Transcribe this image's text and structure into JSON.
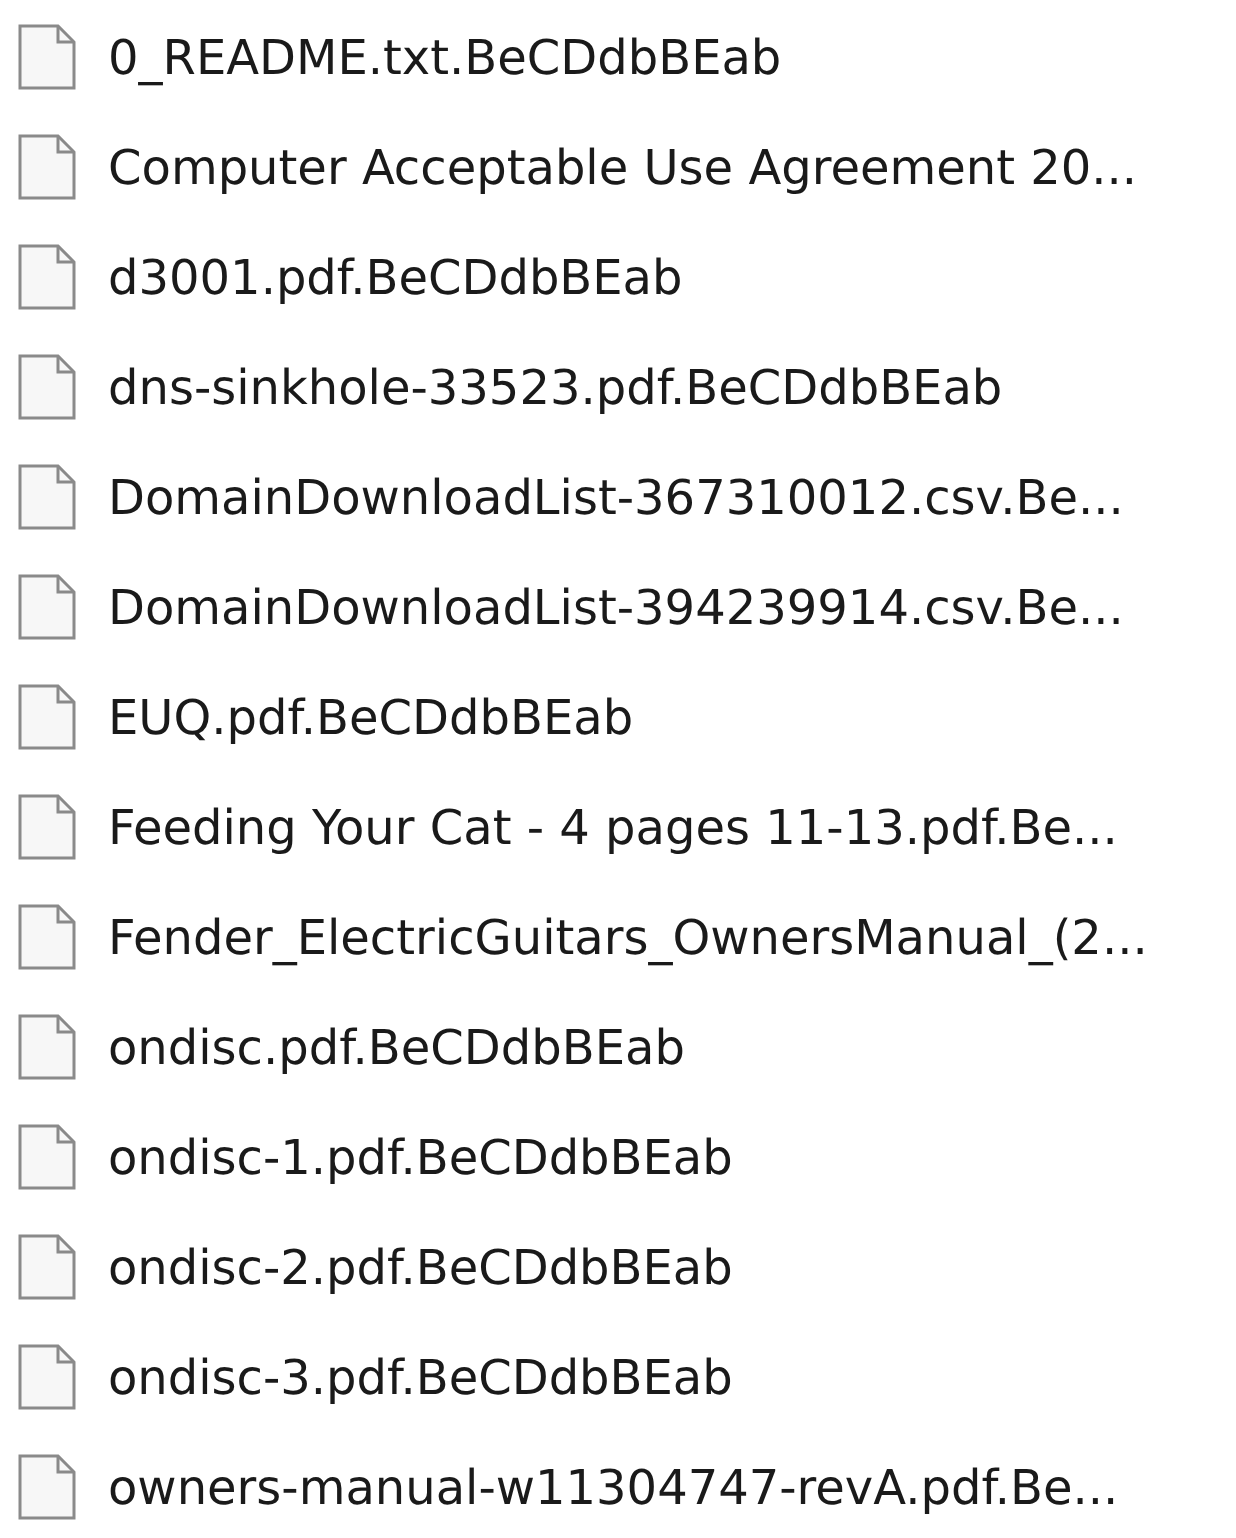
{
  "files": [
    {
      "name": "0_README.txt.BeCDdbBEab"
    },
    {
      "name": "Computer Acceptable Use Agreement 20..."
    },
    {
      "name": "d3001.pdf.BeCDdbBEab"
    },
    {
      "name": "dns-sinkhole-33523.pdf.BeCDdbBEab"
    },
    {
      "name": "DomainDownloadList-367310012.csv.Be..."
    },
    {
      "name": "DomainDownloadList-394239914.csv.Be..."
    },
    {
      "name": "EUQ.pdf.BeCDdbBEab"
    },
    {
      "name": "Feeding Your Cat - 4 pages 11-13.pdf.Be..."
    },
    {
      "name": "Fender_ElectricGuitars_OwnersManual_(2..."
    },
    {
      "name": "ondisc.pdf.BeCDdbBEab"
    },
    {
      "name": "ondisc-1.pdf.BeCDdbBEab"
    },
    {
      "name": "ondisc-2.pdf.BeCDdbBEab"
    },
    {
      "name": "ondisc-3.pdf.BeCDdbBEab"
    },
    {
      "name": "owners-manual-w11304747-revA.pdf.Be..."
    }
  ]
}
